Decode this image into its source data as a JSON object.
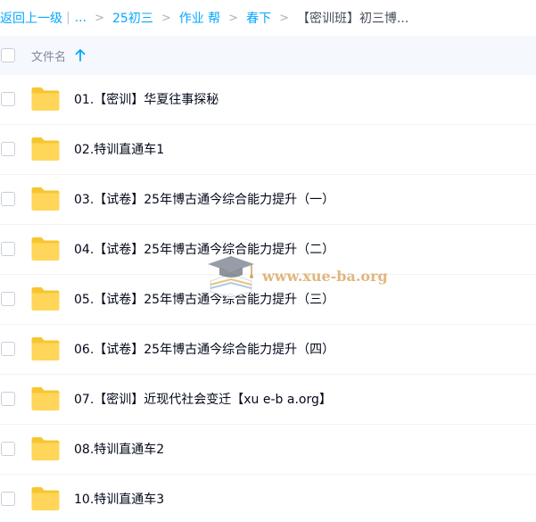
{
  "breadcrumb": {
    "back_label": "返回上一级",
    "pipe": "|",
    "ellipsis": "...",
    "separator": ">",
    "crumbs": [
      "25初三",
      "作业 帮",
      "春下"
    ],
    "current": "【密训班】初三博..."
  },
  "header": {
    "column_label": "文件名",
    "sort_direction": "ascending",
    "sort_icon": "arrow-up-icon"
  },
  "files": [
    {
      "name": "01.【密训】华夏往事探秘",
      "icon": "folder-icon"
    },
    {
      "name": "02.特训直通车1",
      "icon": "folder-icon"
    },
    {
      "name": "03.【试卷】25年博古通今综合能力提升（一）",
      "icon": "folder-icon"
    },
    {
      "name": "04.【试卷】25年博古通今综合能力提升（二）",
      "icon": "folder-icon"
    },
    {
      "name": "05.【试卷】25年博古通今综合能力提升（三）",
      "icon": "folder-icon"
    },
    {
      "name": "06.【试卷】25年博古通今综合能力提升（四）",
      "icon": "folder-icon"
    },
    {
      "name": "07.【密训】近现代社会变迁【xu e-b a.org】",
      "icon": "folder-icon"
    },
    {
      "name": "08.特训直通车2",
      "icon": "folder-icon"
    },
    {
      "name": "10.特训直通车3",
      "icon": "folder-icon"
    }
  ],
  "watermark": {
    "text": "www.xue-ba.org",
    "icon": "graduation-cap-icon"
  },
  "colors": {
    "link": "#06a7ff",
    "header_bg": "#f5f9fd",
    "folder": "#ffd659",
    "folder_tab": "#f7c530",
    "text": "#03081a",
    "muted": "#818999"
  }
}
